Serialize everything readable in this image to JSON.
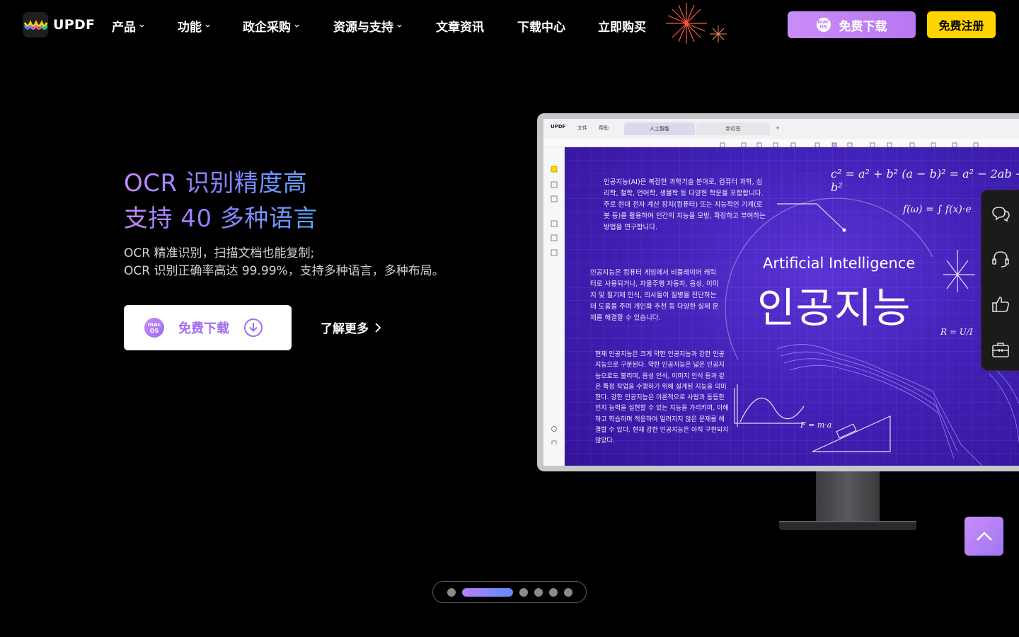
{
  "nav": {
    "logo_text": "UPDF",
    "items": [
      {
        "label": "产品",
        "dropdown": true
      },
      {
        "label": "功能",
        "dropdown": true
      },
      {
        "label": "政企采购",
        "dropdown": true
      },
      {
        "label": "资源与支持",
        "dropdown": true
      },
      {
        "label": "文章资讯",
        "dropdown": false
      },
      {
        "label": "下载中心",
        "dropdown": false
      },
      {
        "label": "立即购买",
        "dropdown": false
      }
    ],
    "download_label": "免费下载",
    "register_label": "免费注册",
    "os_badge": {
      "top": "mac",
      "bottom": "OS"
    }
  },
  "hero": {
    "title_line1": "OCR 识别精度高",
    "title_line2": "支持 40 多种语言",
    "sub_line1": "OCR 精准识别，扫描文档也能复制;",
    "sub_line2": "OCR 识别正确率高达 99.99%，支持多种语言，多种布局。",
    "download_label": "免费下载",
    "learn_more_label": "了解更多"
  },
  "app_window": {
    "brand": "UPDF",
    "menu_file": "文件",
    "menu_help": "帮助",
    "tab_active": "人工智能",
    "tab_inactive": "新标签",
    "tab_add": "+",
    "doc": {
      "para1": "인공지능(AI)은 복잡한 과학기술 분야로, 컴퓨터 과학, 심리학, 철학, 언어학, 생물학 등 다양한 학문을 포함합니다. 주로 현대 전자 계산 장치(컴퓨터) 또는 지능적인 기계(로봇 등)를 활용하여 인간의 지능을 모방, 확장하고 부여하는 방법을 연구합니다.",
      "para2": "인공지능은 컴퓨터 게임에서 비플레이어 캐릭터로 사용되거나, 자율주행 자동차, 음성, 이미지 및 필기체 인식, 의사들이 질병을 진단하는 데 도움을 주며 개인화 추천 등 다양한 실제 문제를 해결할 수 있습니다.",
      "para3": "현재 인공지능은 크게 약한 인공지능과 강한 인공지능으로 구분된다. 약한 인공지능은 넓은 인공지능으로도 불리며, 음성 인식, 이미지 인식 등과 같은 특정 작업을 수행하기 위해 설계된 지능을 의미한다. 강한 인공지능은 이론적으로 사람과 동등한 인지 능력을 실현할 수 있는 지능을 가리키며, 이해하고 학습하며 적응하여 일려지지 않은 문제를 해결할 수 있다. 현재 강한 인공지능은 아직 구현되지 않았다.",
      "heading_en": "Artificial Intelligence",
      "heading_ko": "인공지능",
      "formula1": "c² = a² + b²   (a − b)² = a² − 2ab + b²",
      "formula2": "f(ω) = ∫ f(x)·e",
      "formula3": "F = m·a",
      "formula4": "R = U/I"
    }
  },
  "pagination": {
    "count": 6,
    "active_index": 1
  },
  "colors": {
    "accent_purple": "#b777f2",
    "accent_yellow": "#ffd400",
    "background": "#000000"
  },
  "side_icons": [
    "chat-icon",
    "headset-icon",
    "thumbs-up-icon",
    "toolbox-icon"
  ]
}
